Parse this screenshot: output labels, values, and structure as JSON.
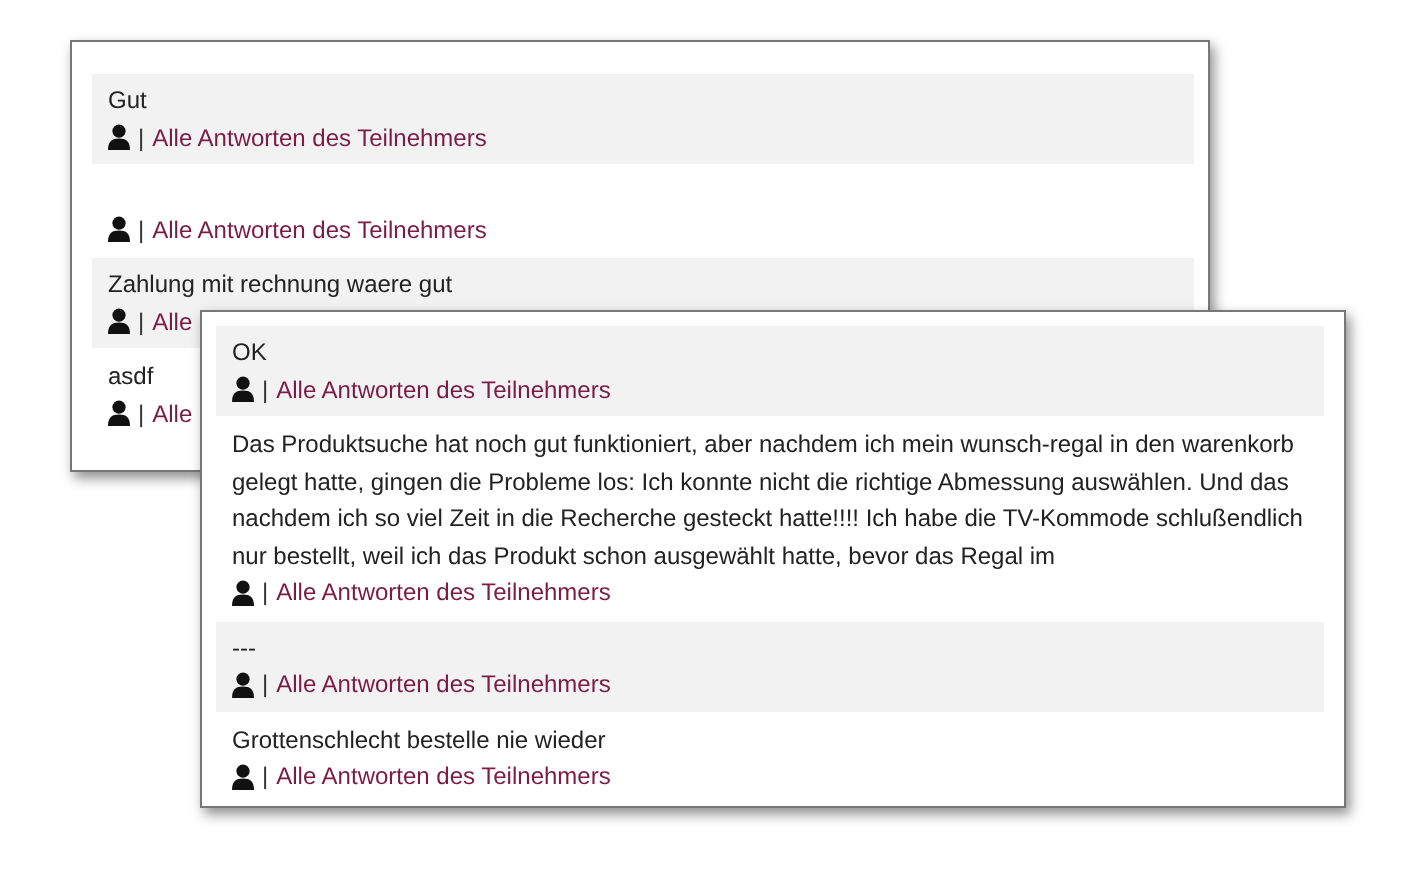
{
  "cards": [
    {
      "entries": [
        {
          "answer": "Gut",
          "separator": "|",
          "link": "Alle Antworten des Teilnehmers"
        },
        {
          "separator": "|",
          "link": "Alle Antworten des Teilnehmers"
        },
        {
          "answer": "Zahlung mit rechnung waere gut",
          "separator": "|",
          "link": "Alle"
        },
        {
          "answer": "asdf",
          "separator": "|",
          "link": "Alle"
        }
      ]
    },
    {
      "entries": [
        {
          "answer": "OK",
          "separator": "|",
          "link": "Alle Antworten des Teilnehmers"
        },
        {
          "answer": "Das Produktsuche hat noch gut funktioniert, aber nachdem ich mein wunsch-regal in den warenkorb gelegt hatte, gingen die Probleme los: Ich konnte nicht die richtige Abmessung auswählen. Und das nachdem ich so viel Zeit in die Recherche gesteckt hatte!!!! Ich habe die TV-Kommode schlußendlich nur bestellt, weil ich das Produkt schon ausgewählt hatte, bevor das Regal im",
          "separator": "|",
          "link": "Alle Antworten des Teilnehmers"
        },
        {
          "answer": "---",
          "separator": "|",
          "link": "Alle Antworten des Teilnehmers"
        },
        {
          "answer": "Grottenschlecht bestelle nie wieder",
          "separator": "|",
          "link": "Alle Antworten des Teilnehmers"
        }
      ]
    }
  ]
}
